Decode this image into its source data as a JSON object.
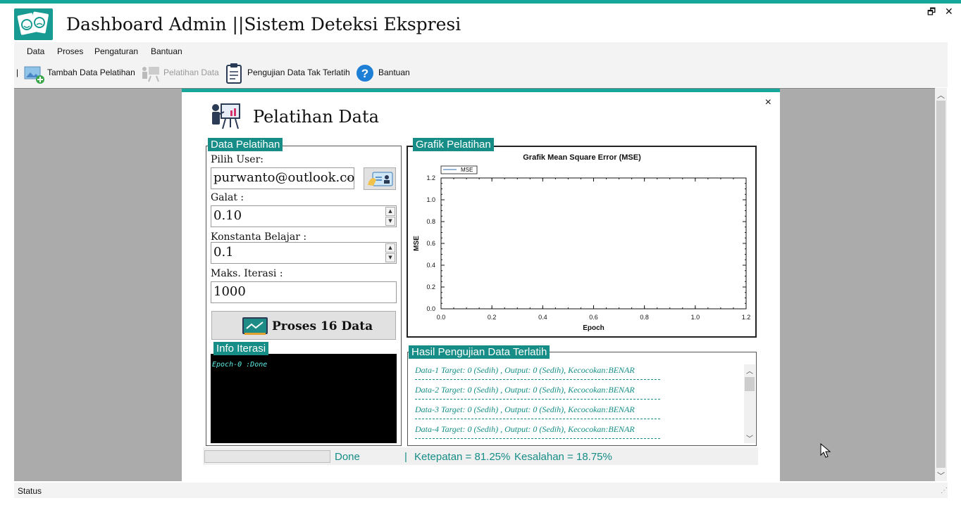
{
  "app": {
    "title": "Dashboard Admin ||Sistem Deteksi Ekspresi"
  },
  "menu": {
    "items": [
      "Data",
      "Proses",
      "Pengaturan",
      "Bantuan"
    ]
  },
  "toolbar": {
    "separator": "|",
    "tambah": "Tambah Data Pelatihan",
    "pelatihan": "Pelatihan Data",
    "pengujian": "Pengujian Data Tak Terlatih",
    "bantuan": "Bantuan"
  },
  "window": {
    "title": "Pelatihan Data",
    "close": "×",
    "data_pelatihan": {
      "group_label": "Data Pelatihan",
      "pilih_user_label": "Pilih User:",
      "pilih_user_value": "purwanto@outlook.co",
      "galat_label": "Galat :",
      "galat_value": "0.10",
      "konstanta_label": "Konstanta Belajar :",
      "konstanta_value": "0.1",
      "maks_label": "Maks. Iterasi :",
      "maks_value": "1000",
      "proses_button": "Proses 16 Data"
    },
    "info_iterasi": {
      "group_label": "Info Iterasi",
      "text": "Epoch-0 :Done"
    },
    "grafik": {
      "group_label": "Grafik Pelatihan"
    },
    "hasil": {
      "group_label": "Hasil Pengujian Data Terlatih",
      "lines": [
        "Data-1 Target: 0 (Sedih) , Output: 0 (Sedih), Kecocokan:BENAR",
        "Data-2 Target: 0 (Sedih) , Output: 0 (Sedih), Kecocokan:BENAR",
        "Data-3 Target: 0 (Sedih) , Output: 0 (Sedih), Kecocokan:BENAR",
        "Data-4 Target: 0 (Sedih) , Output: 0 (Sedih), Kecocokan:BENAR"
      ]
    },
    "bottom": {
      "status": "Done",
      "separator": "|",
      "ketepatan": "Ketepatan = 81.25%",
      "kesalahan": "Kesalahan = 18.75%"
    }
  },
  "statusbar": {
    "text": "Status"
  },
  "colors": {
    "accent": "#17a69a",
    "label_bg": "#168d86",
    "mdi_bg": "#ababab"
  },
  "chart_data": {
    "type": "line",
    "title": "Grafik Mean  Square Error (MSE)",
    "xlabel": "Epoch",
    "ylabel": "MSE",
    "xlim": [
      0.0,
      1.2
    ],
    "ylim": [
      0.0,
      1.2
    ],
    "xticks": [
      "0.0",
      "0.2",
      "0.4",
      "0.6",
      "0.8",
      "1.0",
      "1.2"
    ],
    "yticks": [
      "0.0",
      "0.2",
      "0.4",
      "0.6",
      "0.8",
      "1.0",
      "1.2"
    ],
    "legend": "top-left",
    "series": [
      {
        "name": "MSE",
        "x": [],
        "y": []
      }
    ]
  }
}
